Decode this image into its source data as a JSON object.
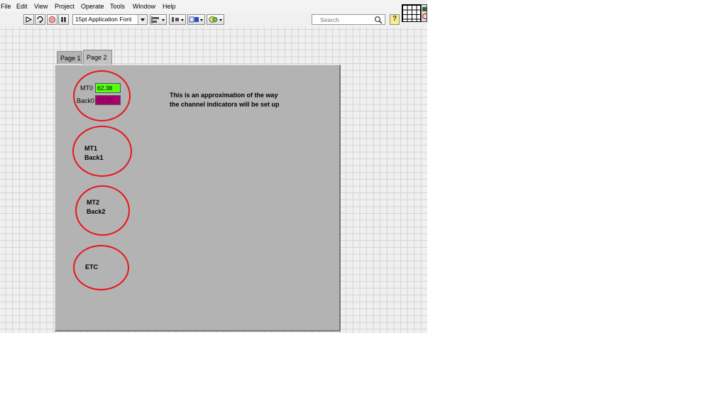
{
  "menu": [
    "File",
    "Edit",
    "View",
    "Project",
    "Operate",
    "Tools",
    "Window",
    "Help"
  ],
  "toolbar": {
    "font_select": "15pt Application Font",
    "search_placeholder": "Search",
    "help_label": "?"
  },
  "tabs": [
    {
      "label": "Page 1",
      "selected": false
    },
    {
      "label": "Page 2",
      "selected": true
    }
  ],
  "channels": {
    "mt0_label": "MT0",
    "mt0_value": "62.38",
    "back0_label": "Back0",
    "back0_value": "62.32",
    "group1": {
      "line1": "MT1",
      "line2": "Back1"
    },
    "group2": {
      "line1": "MT2",
      "line2": "Back2"
    },
    "group3": {
      "line1": "ETC"
    }
  },
  "note": {
    "line1": "This is an approximation of the way",
    "line2": "the channel indicators will be set up"
  },
  "colors": {
    "mt0_indicator": "#55ff11",
    "back0_indicator": "#a8006e",
    "highlight_circle": "#e8151b",
    "panel": "#b3b3b3"
  }
}
